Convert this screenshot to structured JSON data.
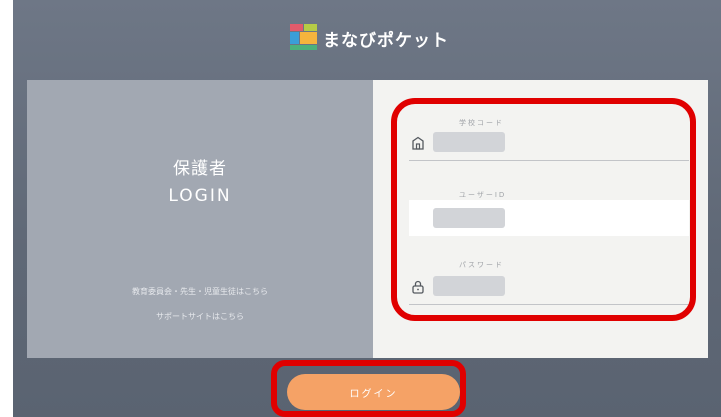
{
  "header": {
    "app_title": "まなびポケット"
  },
  "left_panel": {
    "role_title": "保護者",
    "login_title": "LOGIN",
    "links": [
      "教育委員会・先生・児童生徒はこちら",
      "サポートサイトはこちら"
    ]
  },
  "form": {
    "school_code_label": "学校コード",
    "user_id_label": "ユーザーID",
    "password_label": "パスワード",
    "login_button": "ログイン"
  },
  "colors": {
    "background": "#666f7d",
    "left_panel": "#a2a8b2",
    "form_panel": "#f3f3f1",
    "button": "#f5a266",
    "annotation": "#e00000"
  },
  "icons": [
    "app-logo",
    "building-icon",
    "lock-icon"
  ]
}
